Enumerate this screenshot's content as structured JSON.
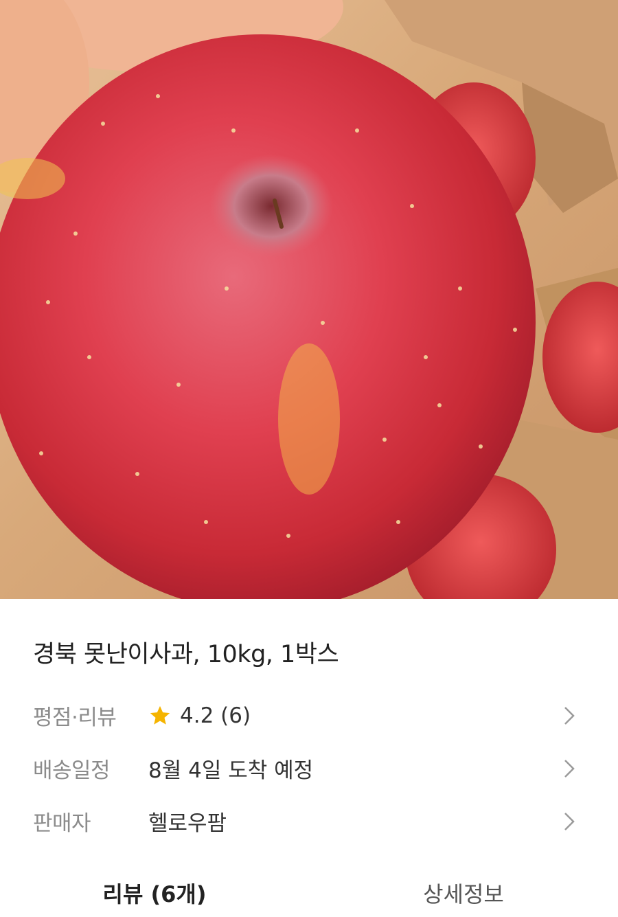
{
  "product": {
    "title": "경북 못난이사과, 10kg, 1박스",
    "image_alt": "apple photo"
  },
  "rows": [
    {
      "label": "평점·리뷰",
      "value": "4.2 (6)",
      "icon": "star-icon",
      "icon_color": "#f5b400"
    },
    {
      "label": "배송일정",
      "value": "8월 4일 도착 예정"
    },
    {
      "label": "판매자",
      "value": "헬로우팜"
    }
  ],
  "tabs": [
    {
      "label": "리뷰 (6개)",
      "active": true
    },
    {
      "label": "상세정보",
      "active": false
    }
  ]
}
